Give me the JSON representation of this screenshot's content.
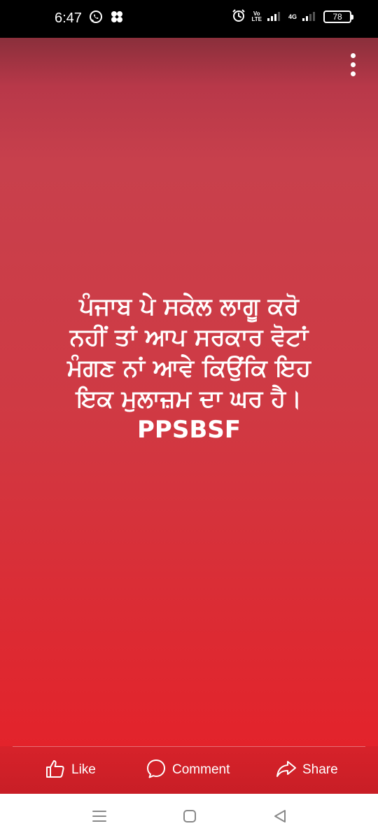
{
  "status_bar": {
    "time": "6:47",
    "left_icons": [
      "whatsapp-icon",
      "pinwheel-icon"
    ],
    "right_icons": [
      "alarm-icon",
      "volte-icon",
      "signal-icon",
      "network-4g-icon",
      "signal-icon",
      "battery-icon"
    ],
    "volte_line1": "Vo",
    "volte_line2": "LTE",
    "network_label": "4G",
    "battery_level": "78"
  },
  "post": {
    "text_lines": [
      "ਪੰਜਾਬ ਪੇ ਸਕੇਲ ਲਾਗੂ ਕਰੋ",
      "ਨਹੀਂ ਤਾਂ ਆਪ ਸਰਕਾਰ ਵੋਟਾਂ",
      "ਮੰਗਣ ਨਾਂ ਆਵੇ ਕਿਉਂਕਿ ਇਹ",
      "ਇਕ ਮੁਲਾਜ਼ਮ ਦਾ ਘਰ ਹੈ।",
      "PPSBSF"
    ],
    "background_colors": [
      "#8a2f3b",
      "#c8404c",
      "#e3232b"
    ],
    "text_color": "#ffffff",
    "menu_icon": "more-vertical-icon"
  },
  "actions": {
    "like_label": "Like",
    "comment_label": "Comment",
    "share_label": "Share",
    "icons": [
      "thumbs-up-icon",
      "comment-bubble-icon",
      "share-arrow-icon"
    ]
  },
  "nav_bar": {
    "icons": [
      "recent-apps-icon",
      "home-icon",
      "back-icon"
    ]
  }
}
